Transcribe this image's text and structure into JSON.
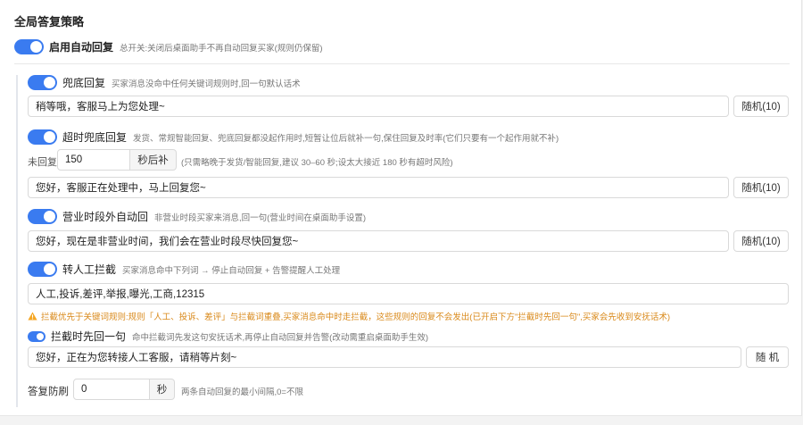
{
  "page": {
    "title": "全局答复策略"
  },
  "master": {
    "label": "启用自动回复",
    "hint": "总开关:关闭后桌面助手不再自动回复买家(规则仍保留)"
  },
  "fallback": {
    "label": "兜底回复",
    "hint": "买家消息没命中任何关键词规则时,回一句默认话术",
    "value": "稍等哦，客服马上为您处理~",
    "random_label": "随机(10)"
  },
  "timeout": {
    "label": "超时兜底回复",
    "hint": "发货、常规智能回复、兜底回复都没起作用时,短暂让位后就补一句,保住回复及时率(它们只要有一个起作用就不补)",
    "no_reply_label": "未回复",
    "seconds_value": "150",
    "seconds_suffix": "秒后补",
    "seconds_hint": "(只需略晚于发货/智能回复,建议 30–60 秒;设太大接近 180 秒有超时风险)",
    "value": "您好，客服正在处理中，马上回复您~",
    "random_label": "随机(10)"
  },
  "offhours": {
    "label": "营业时段外自动回",
    "hint": "非营业时段买家来消息,回一句(营业时间在桌面助手设置)",
    "value": "您好，现在是非营业时间，我们会在营业时段尽快回复您~",
    "random_label": "随机(10)"
  },
  "transfer": {
    "label": "转人工拦截",
    "hint": "买家消息命中下列词 → 停止自动回复 + 告警提醒人工处理",
    "keywords": "人工,投诉,差评,举报,曝光,工商,12315",
    "warning": "拦截优先于关键词规则:规则「人工、投诉、差评」与拦截词重叠,买家消息命中时走拦截，这些规则的回复不会发出(已开启下方\"拦截时先回一句\",买家会先收到安抚话术)"
  },
  "intercept_reply": {
    "label": "拦截时先回一句",
    "hint": "命中拦截词先发这句安抚话术,再停止自动回复并告警(改动需重启桌面助手生效)",
    "value": "您好，正在为您转接人工客服，请稍等片刻~",
    "random_label": "随 机"
  },
  "antispam": {
    "label": "答复防刷",
    "value": "0",
    "suffix": "秒",
    "hint": "两条自动回复的最小间隔,0=不限"
  },
  "colors": {
    "accent": "#3a7bf0",
    "warning": "#d9891a"
  }
}
